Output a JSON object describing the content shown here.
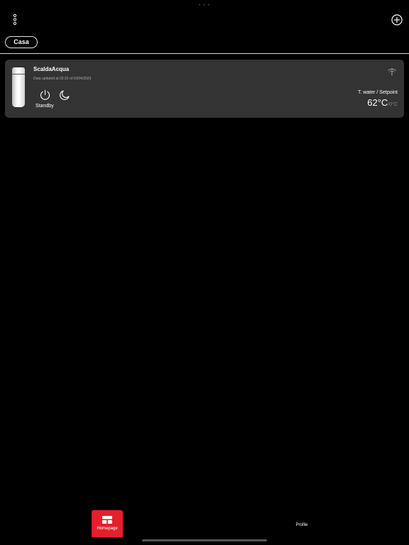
{
  "header": {
    "menu_icon": "vertical-dots-icon",
    "add_icon": "plus-circle-icon"
  },
  "location": {
    "label": "Casa"
  },
  "device": {
    "image_icon": "water-heater-image",
    "name": "ScaldaAcqua",
    "updated": "Data updated at 02:32 of 03/04/2023",
    "power_icon": "power-icon",
    "night_icon": "moon-icon",
    "mode": "Standby",
    "connection_icon": "wifi-off-icon",
    "temp_label": "T. water / Setpoint",
    "water_temp": "62°C",
    "separator": "/",
    "setpoint": "0°C"
  },
  "tabs": {
    "home_label": "Homepage",
    "home_icon": "dashboard-icon",
    "profile_label": "Profile"
  },
  "colors": {
    "accent": "#e3202b",
    "card_bg": "#333333",
    "background": "#000000"
  }
}
